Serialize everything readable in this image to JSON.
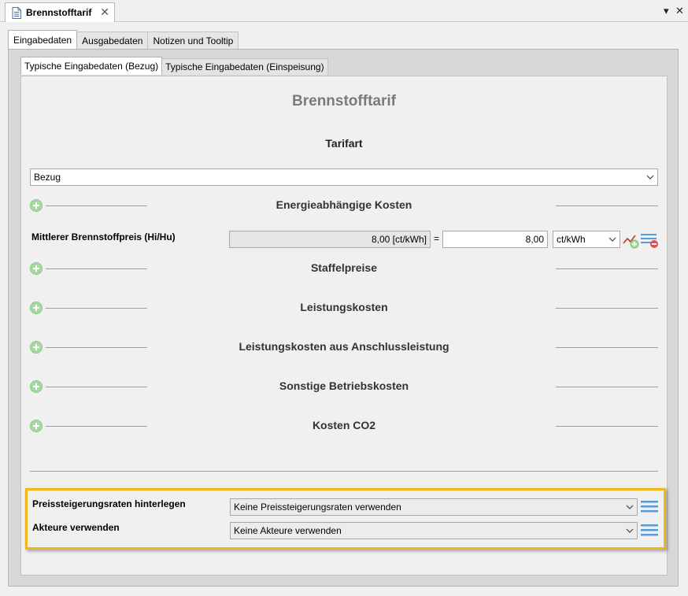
{
  "editor_tab": {
    "title": "Brennstofftarif",
    "close_glyph": "✕"
  },
  "window_controls": {
    "menu_glyph": "▾",
    "close_glyph": "✕"
  },
  "outer_tabs": [
    {
      "label": "Eingabedaten",
      "active": true
    },
    {
      "label": "Ausgabedaten",
      "active": false
    },
    {
      "label": "Notizen und Tooltip",
      "active": false
    }
  ],
  "inner_tabs": [
    {
      "label": "Typische Eingabedaten (Bezug)",
      "active": true
    },
    {
      "label": "Typische Eingabedaten (Einspeisung)",
      "active": false
    }
  ],
  "main": {
    "title": "Brennstofftarif",
    "tarifart_label": "Tarifart",
    "tarifart_value": "Bezug"
  },
  "sections": [
    {
      "title": "Energieabhängige Kosten"
    },
    {
      "title": "Staffelpreise"
    },
    {
      "title": "Leistungskosten"
    },
    {
      "title": "Leistungskosten aus Anschlussleistung"
    },
    {
      "title": "Sonstige Betriebskosten"
    },
    {
      "title": "Kosten CO2"
    }
  ],
  "price_row": {
    "label": "Mittlerer Brennstoffpreis (Hi/Hu)",
    "computed_value": "8,00 [ct/kWh]",
    "equals": "=",
    "input_value": "8,00",
    "unit": "ct/kWh"
  },
  "bottom": {
    "rates_label": "Preissteigerungsraten hinterlegen",
    "rates_value": "Keine Preissteigerungsraten verwenden",
    "actors_label": "Akteure verwenden",
    "actors_value": "Keine Akteure verwenden"
  },
  "colors": {
    "highlight_border": "#f2b616",
    "plus_green": "#a6d9a2",
    "list_icon_blue": "#5b9bd5",
    "remove_red": "#e05050"
  },
  "icons": [
    "document-icon",
    "close-icon",
    "menu-arrow-icon",
    "add-icon",
    "chevron-down-icon",
    "chart-add-icon",
    "list-remove-icon",
    "list-icon"
  ]
}
